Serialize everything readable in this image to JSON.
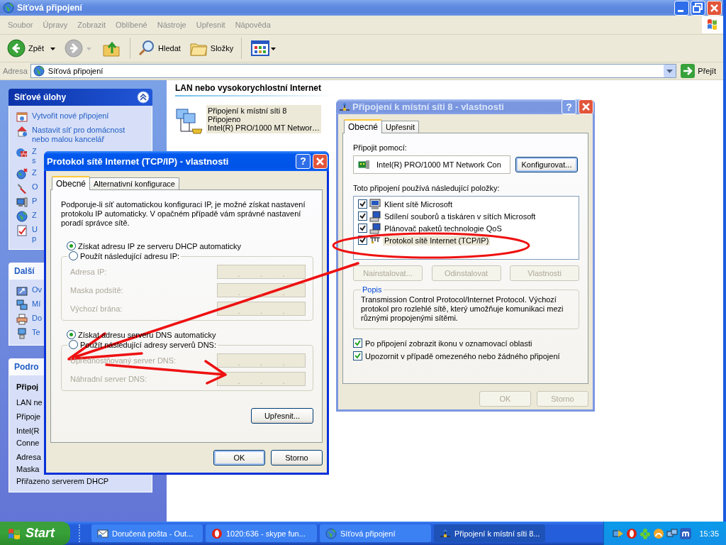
{
  "window": {
    "title": "Síťová připojení"
  },
  "menu": [
    "Soubor",
    "Úpravy",
    "Zobrazit",
    "Oblíbené",
    "Nástroje",
    "Upřesnit",
    "Nápověda"
  ],
  "toolbar": [
    {
      "kind": "back",
      "label": "Zpět",
      "disabled": false
    },
    {
      "kind": "forward",
      "disabled": true
    },
    {
      "kind": "up"
    },
    {
      "kind": "separator"
    },
    {
      "kind": "search",
      "label": "Hledat"
    },
    {
      "kind": "folders",
      "label": "Složky"
    },
    {
      "kind": "separator"
    },
    {
      "kind": "views"
    }
  ],
  "address_bar": {
    "label": "Adresa",
    "value": "Síťová připojení",
    "go": "Přejít"
  },
  "task_pane": [
    {
      "title": "Síťové úlohy",
      "kind": "special",
      "items": [
        {
          "lines": [
            "Vytvořit nové připojení"
          ]
        },
        {
          "lines": [
            "Nastavit síť pro domácnost nebo malou kancelář"
          ]
        },
        {
          "lines": [
            "Z",
            "s"
          ]
        },
        {
          "lines": [
            "Z"
          ]
        },
        {
          "lines": [
            "O"
          ]
        },
        {
          "lines": [
            "P"
          ]
        },
        {
          "lines": [
            "Z"
          ]
        },
        {
          "lines": [
            "U",
            "p"
          ]
        }
      ]
    },
    {
      "title": "Další",
      "kind": "plain",
      "items": [
        {
          "lines": [
            "Ov"
          ]
        },
        {
          "lines": [
            "Mí"
          ]
        },
        {
          "lines": [
            "Do"
          ]
        },
        {
          "lines": [
            "Te"
          ]
        }
      ]
    },
    {
      "title": "Podro",
      "kind": "plain",
      "details": [
        {
          "kind": "heading",
          "text": "Připoj"
        },
        {
          "kind": "line",
          "text": "LAN ne"
        },
        {
          "kind": "line",
          "text": "Připoje"
        },
        {
          "kind": "line",
          "text": "Intel(R"
        },
        {
          "kind": "cont",
          "text": "Conne"
        },
        {
          "kind": "line",
          "text": "Adresa"
        },
        {
          "kind": "cont",
          "text": "Maska"
        },
        {
          "kind": "cont",
          "text": "Přiřazeno serverem DHCP"
        }
      ]
    }
  ],
  "content": {
    "group": "LAN nebo vysokorychlostní Internet",
    "connections": [
      {
        "lines": [
          "Připojení k místní síti 8",
          "Připojeno",
          "Intel(R) PRO/1000 MT Networ…"
        ],
        "selected": true
      }
    ]
  },
  "lan_dialog": {
    "title": "Připojení k místní síti 8 - vlastnosti",
    "active": false,
    "help": "?",
    "tabs": [
      {
        "label": "Obecné",
        "selected": true
      },
      {
        "label": "Upřesnit",
        "selected": false
      }
    ],
    "connect_using_label": "Připojit pomocí:",
    "adapter": "Intel(R) PRO/1000 MT Network Con",
    "configure_button": "Konfigurovat...",
    "components_label": "Toto připojení používá následující položky:",
    "components": [
      {
        "label": "Klient sítě Microsoft",
        "checked": true,
        "selected": false
      },
      {
        "label": "Sdílení souborů a tiskáren v sítích Microsoft",
        "checked": true,
        "selected": false
      },
      {
        "label": "Plánovač paketů technologie QoS",
        "checked": true,
        "selected": false
      },
      {
        "label": "Protokol sítě Internet (TCP/IP)",
        "checked": true,
        "selected": true
      }
    ],
    "component_buttons": [
      {
        "label": "Nainstalovat...",
        "disabled": true
      },
      {
        "label": "Odinstalovat",
        "disabled": true
      },
      {
        "label": "Vlastnosti",
        "disabled": true
      }
    ],
    "description": {
      "legend": "Popis",
      "text": "Transmission Control Protocol/Internet Protocol. Výchozí protokol pro rozlehlé sítě, který umožňuje komunikaci mezi různými propojenými sítěmi."
    },
    "options": [
      {
        "label": "Po připojení zobrazit ikonu v oznamovací oblasti",
        "checked": true
      },
      {
        "label": "Upozornit v případě omezeného nebo žádného připojení",
        "checked": true
      }
    ],
    "buttons": [
      {
        "label": "OK",
        "disabled": true
      },
      {
        "label": "Storno",
        "disabled": true
      }
    ]
  },
  "tcp_dialog": {
    "title": "Protokol sítě Internet (TCP/IP) - vlastnosti",
    "active": true,
    "help": "?",
    "tabs": [
      {
        "label": "Obecné",
        "selected": true
      },
      {
        "label": "Alternativní konfigurace",
        "selected": false
      }
    ],
    "intro": "Podporuje-li síť automatickou konfiguraci IP, je možné získat nastavení protokolu IP automaticky. V opačném případě vám správné nastavení poradí správce sítě.",
    "ip_options": [
      {
        "label": "Získat adresu IP ze serveru DHCP automaticky",
        "selected": true
      },
      {
        "label": "Použít následující adresu IP:",
        "selected": false
      }
    ],
    "ip_fields": [
      {
        "label": "Adresa IP:",
        "disabled": true,
        "separators": [
          ".",
          ".",
          "."
        ]
      },
      {
        "label": "Maska podsítě:",
        "disabled": true,
        "separators": [
          ".",
          ".",
          "."
        ]
      },
      {
        "label": "Výchozí brána:",
        "disabled": true,
        "separators": [
          ".",
          ".",
          "."
        ]
      }
    ],
    "dns_options": [
      {
        "label": "Získat adresu serveru DNS automaticky",
        "selected": true
      },
      {
        "label": "Použít následující adresy serverů DNS:",
        "selected": false
      }
    ],
    "dns_fields": [
      {
        "label": "Upřednostňovaný server DNS:",
        "disabled": true,
        "separators": [
          ".",
          ".",
          "."
        ]
      },
      {
        "label": "Náhradní server DNS:",
        "disabled": true,
        "separators": [
          ".",
          ".",
          "."
        ]
      }
    ],
    "advanced_button": "Upřesnit...",
    "buttons": [
      {
        "label": "OK",
        "default": true
      },
      {
        "label": "Storno",
        "default": false
      }
    ]
  },
  "taskbar": {
    "start": "Start",
    "tasks": [
      {
        "label": "Doručená pošta - Out...",
        "selected": false
      },
      {
        "label": "1020:636 - skype fun...",
        "selected": false
      },
      {
        "label": "Síťová připojení",
        "selected": false
      },
      {
        "label": "Připojení k místní síti 8...",
        "selected": true
      }
    ],
    "clock": "15:35"
  }
}
